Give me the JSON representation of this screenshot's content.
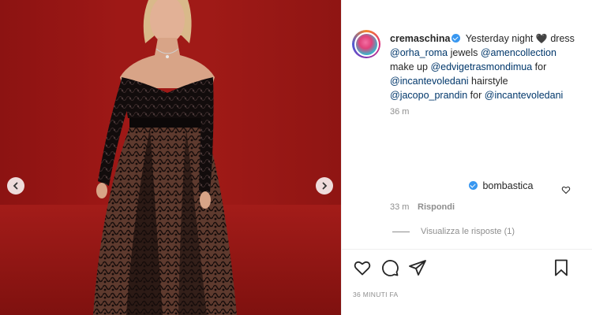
{
  "post": {
    "username": "cremaschina",
    "caption_lead": "Yesterday night",
    "caption_heart": "🖤",
    "caption_dress": "dress",
    "mention_orha": "@orha_roma",
    "jewels_label": "jewels",
    "mention_amen": "@amencollection",
    "makeup_label": "make up",
    "mention_edvige": "@edvigetrasmondimua",
    "for_label_1": "for",
    "mention_incantevole_1": "@incantevoledani",
    "hairstyle_label": "hairstyle",
    "mention_jacopo": "@jacopo_prandin",
    "for_label_2": "for",
    "mention_incantevole_2": "@incantevoledani",
    "caption_time": "36 m",
    "timestamp": "36 MINUTI FA"
  },
  "comment": {
    "username": "bombastica",
    "time": "33 m",
    "reply_label": "Rispondi",
    "view_replies": "Visualizza le risposte (1)"
  },
  "icons": {
    "like": "heart-icon",
    "comment": "comment-icon",
    "share": "share-icon",
    "save": "bookmark-icon",
    "prev": "chevron-left-icon",
    "next": "chevron-right-icon"
  },
  "colors": {
    "verified": "#3897f0",
    "mention": "#00376b",
    "muted": "#8e8e8e",
    "backdrop": "#9e1816"
  }
}
